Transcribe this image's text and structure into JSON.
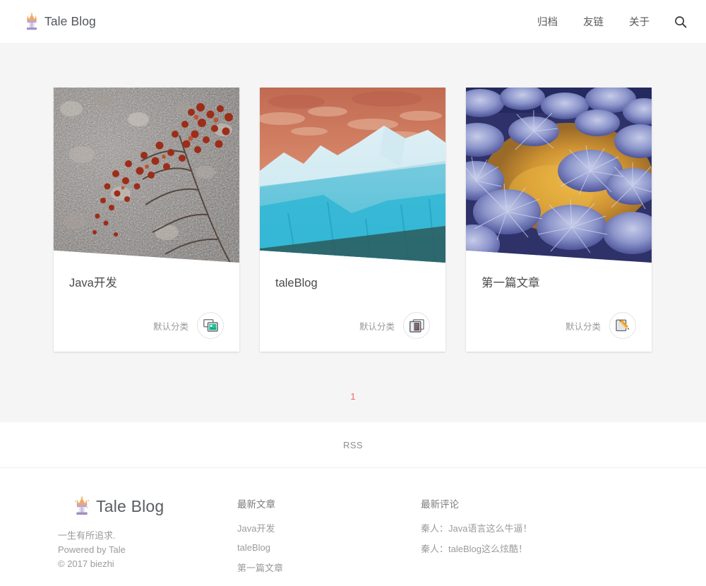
{
  "header": {
    "brand": "Tale Blog",
    "brand_icon": "trophy-icon",
    "nav": [
      {
        "label": "归档",
        "name": "nav-archive"
      },
      {
        "label": "友链",
        "name": "nav-links"
      },
      {
        "label": "关于",
        "name": "nav-about"
      }
    ],
    "search_icon": "search-icon"
  },
  "main": {
    "cards": [
      {
        "title": "Java开发",
        "category": "默认分类",
        "icon": "photo-icon",
        "image": "red-berries-on-gravel"
      },
      {
        "title": "taleBlog",
        "category": "默认分类",
        "icon": "windows-stack-icon",
        "image": "blue-glacier-at-sunset"
      },
      {
        "title": "第一篇文章",
        "category": "默认分类",
        "icon": "pencil-edit-icon",
        "image": "frosted-blue-grass-tufts"
      }
    ],
    "pagination": {
      "current": "1"
    }
  },
  "rss": {
    "label": "RSS"
  },
  "footer": {
    "brand": "Tale Blog",
    "brand_icon": "trophy-icon",
    "about": {
      "line1": "一生有所追求.",
      "line2": "Powered by Tale",
      "line3": "© 2017 biezhi"
    },
    "posts": {
      "title": "最新文章",
      "items": [
        "Java开发",
        "taleBlog",
        "第一篇文章"
      ]
    },
    "comments": {
      "title": "最新评论",
      "items": [
        "秦人：Java语言这么牛逼！",
        "秦人：taleBlog这么炫酷！"
      ]
    }
  },
  "colors": {
    "accent": "#f4645f",
    "page_bg": "#f5f5f5",
    "text": "#4a4a4a",
    "muted": "#9b9b9b"
  }
}
